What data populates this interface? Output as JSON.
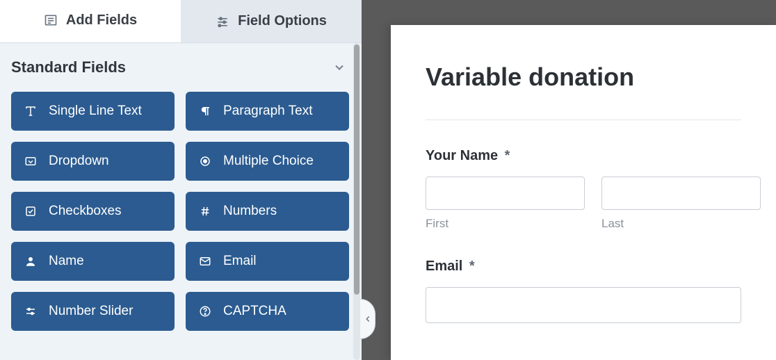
{
  "tabs": {
    "add_fields": "Add Fields",
    "field_options": "Field Options"
  },
  "section": {
    "title": "Standard Fields"
  },
  "fields": {
    "single_line_text": "Single Line Text",
    "paragraph_text": "Paragraph Text",
    "dropdown": "Dropdown",
    "multiple_choice": "Multiple Choice",
    "checkboxes": "Checkboxes",
    "numbers": "Numbers",
    "name": "Name",
    "email": "Email",
    "number_slider": "Number Slider",
    "captcha": "CAPTCHA"
  },
  "form": {
    "title": "Variable donation",
    "name_label": "Your Name",
    "name_required": "*",
    "first_sub": "First",
    "last_sub": "Last",
    "email_label": "Email",
    "email_required": "*"
  }
}
